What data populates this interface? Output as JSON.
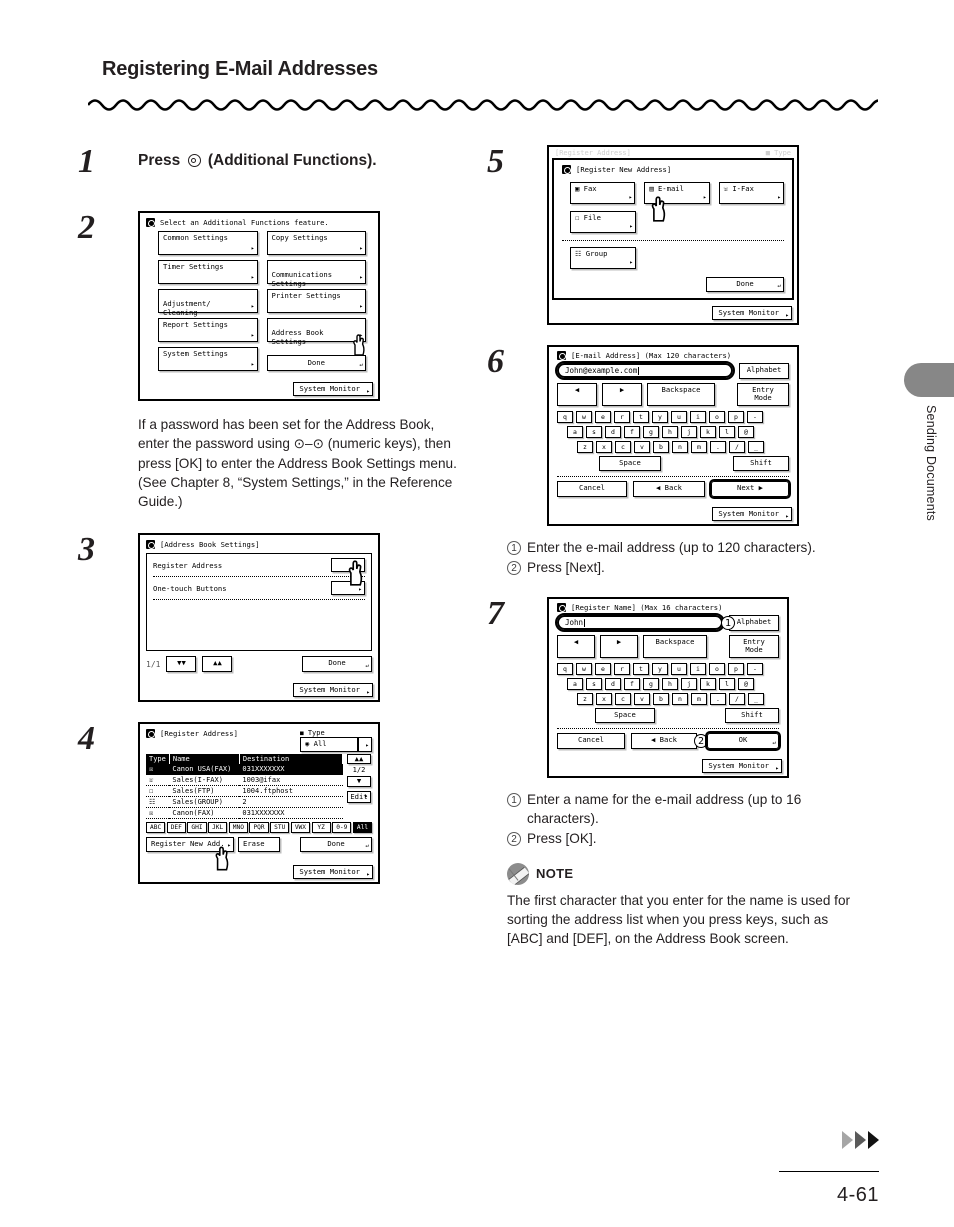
{
  "page": {
    "title": "Registering E-Mail Addresses",
    "number": "4-61",
    "side_tab_label": "Sending Documents"
  },
  "steps": {
    "s1": {
      "num": "1",
      "lead_before": "Press",
      "lead_icon": "additional-functions-icon",
      "lead_after": "(Additional Functions)."
    },
    "s2": {
      "num": "2",
      "screen": {
        "title": "Select an Additional Functions feature.",
        "buttons": [
          "Common Settings",
          "Copy Settings",
          "Timer Settings",
          "Communications\nSettings",
          "Adjustment/\nCleaning",
          "Printer Settings",
          "Report Settings",
          "Address Book\nSettings",
          "System Settings"
        ],
        "done": "Done",
        "system_monitor": "System Monitor"
      },
      "paragraph": "If a password has been set for the Address Book, enter the password using ⊙–⊙ (numeric keys), then press [OK] to enter the Address Book Settings menu. (See Chapter 8, “System Settings,” in the Reference Guide.)"
    },
    "s3": {
      "num": "3",
      "screen": {
        "title": "[Address Book Settings]",
        "rows": [
          "Register Address",
          "One-touch Buttons"
        ],
        "page_indicator": "1/1",
        "done": "Done",
        "system_monitor": "System Monitor"
      }
    },
    "s4": {
      "num": "4",
      "screen": {
        "title": "[Register Address]",
        "type_label": "Type",
        "type_value": "All",
        "columns": [
          "Type",
          "Name",
          "Destination"
        ],
        "rows": [
          {
            "icon": "fax-icon",
            "name": "Canon USA(FAX)",
            "destination": "031XXXXXXX",
            "selected": true
          },
          {
            "icon": "ifax-icon",
            "name": "Sales(I-FAX)",
            "destination": "1003@ifax",
            "selected": false
          },
          {
            "icon": "file-icon",
            "name": "Sales(FTP)",
            "destination": "1004.ftphost",
            "selected": false
          },
          {
            "icon": "group-icon",
            "name": "Sales(GROUP)",
            "destination": "2",
            "selected": false
          },
          {
            "icon": "fax-icon",
            "name": "Canon(FAX)",
            "destination": "031XXXXXXX",
            "selected": false
          }
        ],
        "page_indicator": "1/2",
        "edit": "Edit",
        "alpha_keys": [
          "ABC",
          "DEF",
          "GHI",
          "JKL",
          "MNO",
          "PQR",
          "STU",
          "VWX",
          "YZ",
          "0-9",
          "All"
        ],
        "alpha_selected": "All",
        "register_new": "Register New Add.",
        "erase": "Erase",
        "done": "Done",
        "system_monitor": "System Monitor"
      }
    },
    "s5": {
      "num": "5",
      "screen": {
        "ghost_title": "[Register Address]",
        "ghost_type": "Type",
        "title": "[Register New Address]",
        "buttons": [
          "Fax",
          "E-mail",
          "I-Fax",
          "File",
          "Group"
        ],
        "done": "Done",
        "system_monitor": "System Monitor"
      }
    },
    "s6": {
      "num": "6",
      "screen": {
        "title": "[E-mail Address] (Max 120 characters)",
        "field_value": "John@example.com",
        "alphabet": "Alphabet",
        "nav_left": "◀",
        "nav_right": "▶",
        "backspace": "Backspace",
        "entry_mode": "Entry Mode",
        "kb_row1": [
          "q",
          "w",
          "e",
          "r",
          "t",
          "y",
          "u",
          "i",
          "o",
          "p",
          "-"
        ],
        "kb_row2": [
          "a",
          "s",
          "d",
          "f",
          "g",
          "h",
          "j",
          "k",
          "l",
          "@"
        ],
        "kb_row3": [
          "z",
          "x",
          "c",
          "v",
          "b",
          "n",
          "m",
          ".",
          "/",
          "_"
        ],
        "space": "Space",
        "shift": "Shift",
        "cancel": "Cancel",
        "back": "Back",
        "next": "Next",
        "system_monitor": "System Monitor"
      },
      "instructions": [
        {
          "marker": "1",
          "text": "Enter the e-mail address (up to 120 characters)."
        },
        {
          "marker": "2",
          "text": "Press [Next]."
        }
      ]
    },
    "s7": {
      "num": "7",
      "screen": {
        "title": "[Register Name] (Max 16 characters)",
        "field_value": "John",
        "alphabet": "Alphabet",
        "badge1": "1",
        "badge2": "2",
        "nav_left": "◀",
        "nav_right": "▶",
        "backspace": "Backspace",
        "entry_mode": "Entry Mode",
        "kb_row1": [
          "q",
          "w",
          "e",
          "r",
          "t",
          "y",
          "u",
          "i",
          "o",
          "p",
          "-"
        ],
        "kb_row2": [
          "a",
          "s",
          "d",
          "f",
          "g",
          "h",
          "j",
          "k",
          "l",
          "@"
        ],
        "kb_row3": [
          "z",
          "x",
          "c",
          "v",
          "b",
          "n",
          "m",
          ".",
          "/",
          "_"
        ],
        "space": "Space",
        "shift": "Shift",
        "cancel": "Cancel",
        "back": "Back",
        "ok": "OK",
        "system_monitor": "System Monitor"
      },
      "instructions": [
        {
          "marker": "1",
          "text": "Enter a name for the e-mail address (up to 16 characters)."
        },
        {
          "marker": "2",
          "text": "Press [OK]."
        }
      ]
    }
  },
  "note": {
    "label": "NOTE",
    "text": "The first character that you enter for the name is used for sorting the address list when you press keys, such as [ABC] and [DEF], on the Address Book screen."
  }
}
